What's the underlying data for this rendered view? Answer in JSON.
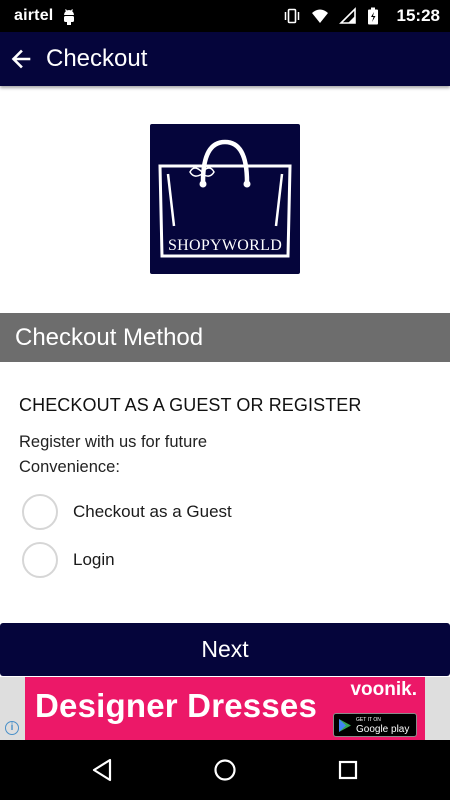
{
  "status_bar": {
    "carrier": "airtel",
    "time": "15:28",
    "icons": [
      "android-icon",
      "vibrate-icon",
      "wifi-icon",
      "signal-icon",
      "battery-icon"
    ]
  },
  "app_bar": {
    "title": "Checkout",
    "back_icon": "arrow-left-icon"
  },
  "logo": {
    "text": "SHOPYWORLD",
    "background": "#05053b"
  },
  "section": {
    "title": "Checkout Method"
  },
  "content": {
    "heading": "CHECKOUT AS A GUEST OR REGISTER",
    "sub_text": "Register with us for future Convenience:",
    "options": [
      {
        "label": "Checkout as a Guest",
        "selected": false
      },
      {
        "label": "Login",
        "selected": false
      }
    ]
  },
  "next_button": {
    "label": "Next"
  },
  "ad": {
    "title": "Designer Dresses",
    "brand": "voonik.",
    "store_small": "GET IT ON",
    "store_big": "Google play",
    "info_icon": "i",
    "color": "#ec1868"
  },
  "nav": {
    "icons": [
      "back-triangle-icon",
      "home-circle-icon",
      "recents-square-icon"
    ]
  },
  "colors": {
    "primary": "#05053b",
    "section_header": "#6d6d6d"
  }
}
